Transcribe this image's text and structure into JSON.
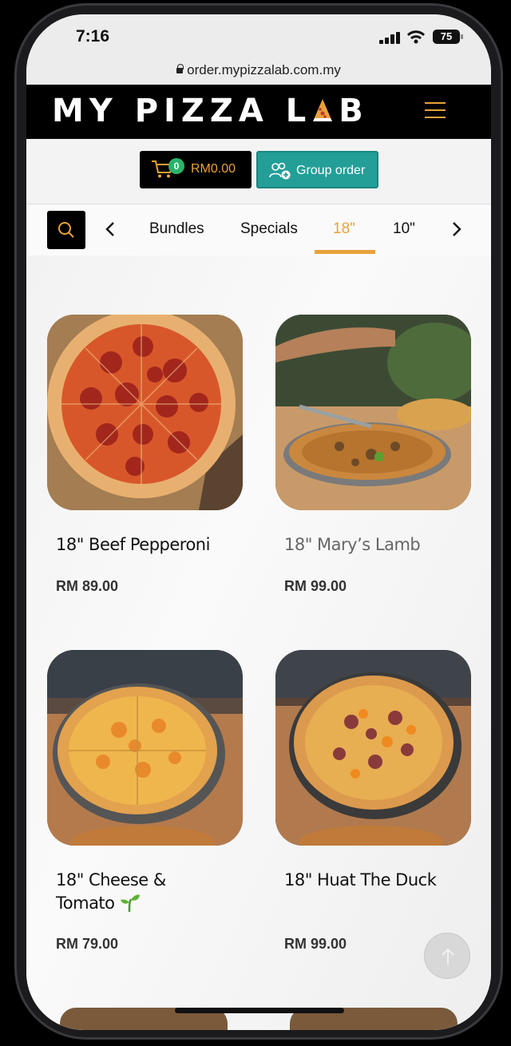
{
  "status": {
    "time": "7:16",
    "battery": "75"
  },
  "browser": {
    "url": "order.mypizzalab.com.my"
  },
  "header": {
    "logo_text_a": "MY PIZZA L",
    "logo_text_b": "B"
  },
  "cart": {
    "count": "0",
    "amount": "RM0.00"
  },
  "group_order": {
    "label": "Group order"
  },
  "categories": [
    {
      "label": "Bundles",
      "active": false
    },
    {
      "label": "Specials",
      "active": false
    },
    {
      "label": "18\"",
      "active": true
    },
    {
      "label": "10\"",
      "active": false
    }
  ],
  "products": [
    {
      "name": "18\" Beef Pepperoni",
      "price": "RM 89.00"
    },
    {
      "name": "18\" Mary’s Lamb",
      "price": "RM 99.00"
    },
    {
      "name": "18\" Cheese & Tomato 🌱",
      "name_line1": "18\" Cheese &",
      "name_line2": "Tomato",
      "price": "RM 79.00"
    },
    {
      "name": "18\" Huat The Duck",
      "price": "RM 99.00"
    }
  ],
  "colors": {
    "accent": "#e8a23a",
    "group_button": "#239f98",
    "cart_badge": "#2bb36a"
  },
  "icons": [
    "cart-icon",
    "group-icon",
    "search-icon",
    "chevron-left-icon",
    "chevron-right-icon",
    "menu-icon",
    "arrow-up-icon",
    "lock-icon"
  ]
}
